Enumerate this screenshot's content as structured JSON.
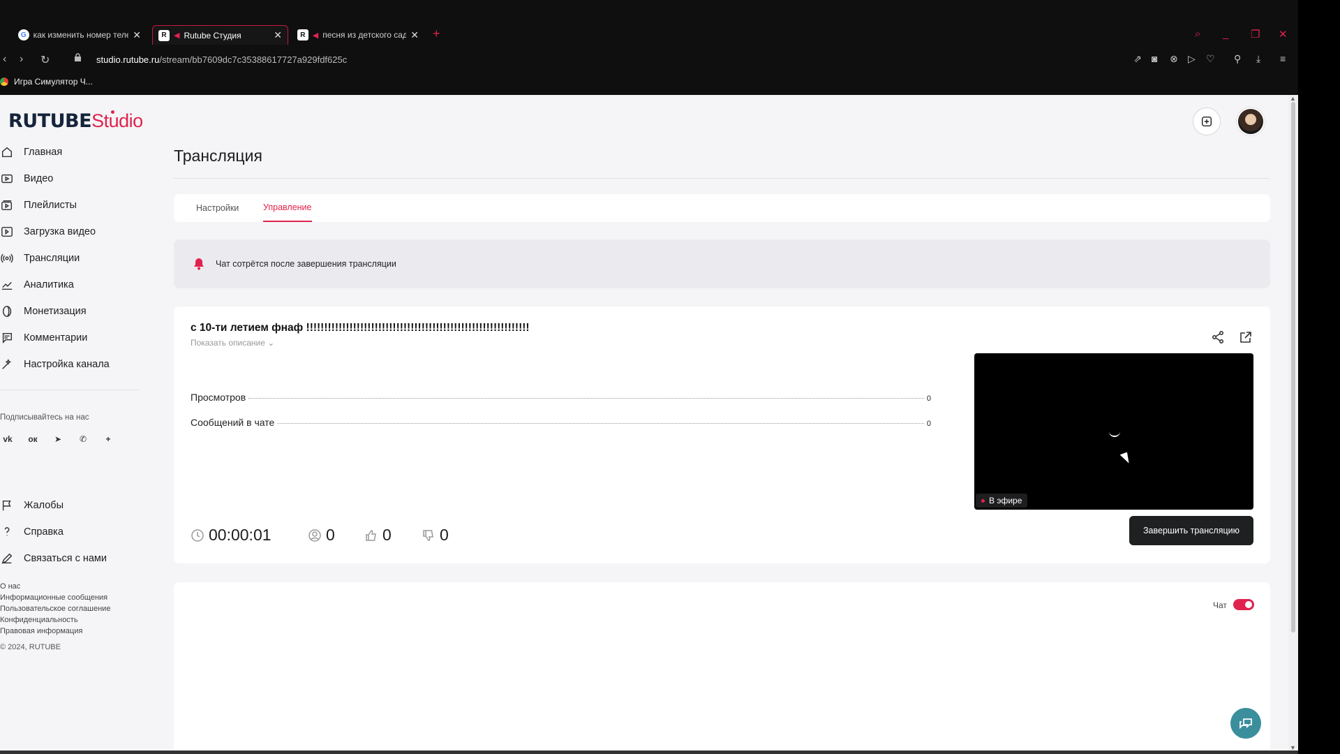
{
  "browser": {
    "tabs": [
      {
        "title": "как изменить номер теле",
        "favicon": "google-icon"
      },
      {
        "title": "Rutube Студия",
        "favicon": "rutube-icon",
        "active": true
      },
      {
        "title": "песня из детского сад",
        "favicon": "rutube-icon"
      }
    ],
    "url_host": "studio.rutube.ru",
    "url_path": "/stream/bb7609dc7c35388617727a929fdf625c",
    "bookmark": "Игра Симулятор Ч..."
  },
  "logo": {
    "ru": "RUTUBE",
    "studio": "Studio"
  },
  "sidebar": {
    "items": [
      {
        "label": "Главная",
        "icon": "home-icon"
      },
      {
        "label": "Видео",
        "icon": "video-icon"
      },
      {
        "label": "Плейлисты",
        "icon": "playlist-icon"
      },
      {
        "label": "Загрузка видео",
        "icon": "upload-icon"
      },
      {
        "label": "Трансляции",
        "icon": "broadcast-icon"
      },
      {
        "label": "Аналитика",
        "icon": "analytics-icon"
      },
      {
        "label": "Монетизация",
        "icon": "coin-icon"
      },
      {
        "label": "Комментарии",
        "icon": "comments-icon"
      },
      {
        "label": "Настройка канала",
        "icon": "wand-icon"
      }
    ],
    "follow_title": "Подписывайтесь на нас",
    "support_items": [
      {
        "label": "Жалобы",
        "icon": "flag-icon"
      },
      {
        "label": "Справка",
        "icon": "question-icon"
      },
      {
        "label": "Связаться с нами",
        "icon": "pencil-icon"
      }
    ],
    "footer_links": [
      "О нас",
      "Информационные сообщения",
      "Пользовательское соглашение",
      "Конфиденциальность",
      "Правовая информация"
    ],
    "copyright": "© 2024, RUTUBE"
  },
  "main": {
    "page_title": "Трансляция",
    "tabs": [
      {
        "label": "Настройки"
      },
      {
        "label": "Управление",
        "active": true
      }
    ],
    "notice": "Чат сотрётся после завершения трансляции",
    "stream": {
      "title": "с 10-ти летием фнаф !!!!!!!!!!!!!!!!!!!!!!!!!!!!!!!!!!!!!!!!!!!!!!!!!!!!!!!!!!!!!!",
      "show_description": "Показать описание",
      "stats": [
        {
          "label": "Просмотров",
          "value": "0"
        },
        {
          "label": "Сообщений в чате",
          "value": "0"
        }
      ],
      "duration": "00:00:01",
      "viewers": "0",
      "likes": "0",
      "dislikes": "0",
      "live_badge": "В эфире",
      "end_button": "Завершить трансляцию"
    },
    "chat": {
      "label": "Чат",
      "enabled": true
    }
  },
  "colors": {
    "accent": "#e0234e",
    "dark": "#1e2022",
    "support": "#3b8e9c"
  }
}
